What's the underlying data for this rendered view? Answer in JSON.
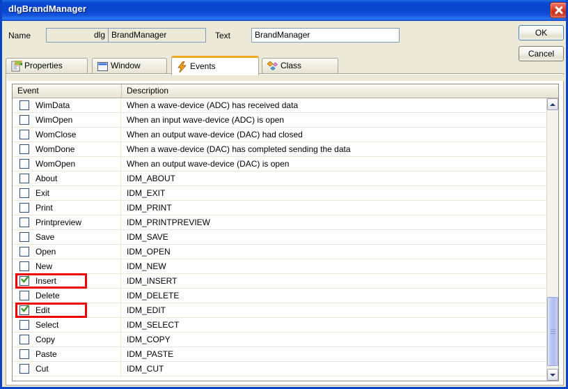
{
  "window": {
    "title": "dlgBrandManager",
    "close_icon": "close-icon"
  },
  "form": {
    "name_label": "Name",
    "name_prefix_value": "dlg",
    "name_value": "BrandManager",
    "text_label": "Text",
    "text_value": "BrandManager",
    "ok_label": "OK",
    "cancel_label": "Cancel"
  },
  "tabs": [
    {
      "label": "Properties",
      "icon": "properties-document-icon",
      "active": false
    },
    {
      "label": "Window",
      "icon": "window-icon",
      "active": false
    },
    {
      "label": "Events",
      "icon": "lightning-bolt-icon",
      "active": true
    },
    {
      "label": "Class",
      "icon": "class-diamonds-icon",
      "active": false
    }
  ],
  "list": {
    "columns": [
      "Event",
      "Description"
    ],
    "rows": [
      {
        "event": "WimData",
        "description": "When a wave-device (ADC) has received data",
        "checked": false,
        "annotated": false
      },
      {
        "event": "WimOpen",
        "description": "When an input wave-device (ADC) is open",
        "checked": false,
        "annotated": false
      },
      {
        "event": "WomClose",
        "description": "When an output wave-device (DAC) had closed",
        "checked": false,
        "annotated": false
      },
      {
        "event": "WomDone",
        "description": "When a wave-device (DAC) has completed sending the data",
        "checked": false,
        "annotated": false
      },
      {
        "event": "WomOpen",
        "description": "When an output wave-device (DAC) is open",
        "checked": false,
        "annotated": false
      },
      {
        "event": "About",
        "description": "IDM_ABOUT",
        "checked": false,
        "annotated": false
      },
      {
        "event": "Exit",
        "description": "IDM_EXIT",
        "checked": false,
        "annotated": false
      },
      {
        "event": "Print",
        "description": "IDM_PRINT",
        "checked": false,
        "annotated": false
      },
      {
        "event": "Printpreview",
        "description": "IDM_PRINTPREVIEW",
        "checked": false,
        "annotated": false
      },
      {
        "event": "Save",
        "description": "IDM_SAVE",
        "checked": false,
        "annotated": false
      },
      {
        "event": "Open",
        "description": "IDM_OPEN",
        "checked": false,
        "annotated": false
      },
      {
        "event": "New",
        "description": "IDM_NEW",
        "checked": false,
        "annotated": false
      },
      {
        "event": "Insert",
        "description": "IDM_INSERT",
        "checked": true,
        "annotated": true
      },
      {
        "event": "Delete",
        "description": "IDM_DELETE",
        "checked": false,
        "annotated": false
      },
      {
        "event": "Edit",
        "description": "IDM_EDIT",
        "checked": true,
        "annotated": true
      },
      {
        "event": "Select",
        "description": "IDM_SELECT",
        "checked": false,
        "annotated": false
      },
      {
        "event": "Copy",
        "description": "IDM_COPY",
        "checked": false,
        "annotated": false
      },
      {
        "event": "Paste",
        "description": "IDM_PASTE",
        "checked": false,
        "annotated": false
      },
      {
        "event": "Cut",
        "description": "IDM_CUT",
        "checked": false,
        "annotated": false
      }
    ],
    "scrollbar": {
      "up_icon": "scroll-up-arrow-icon",
      "down_icon": "scroll-down-arrow-icon"
    }
  },
  "colors": {
    "titlebar_blue": "#0b45cd",
    "dialog_face": "#ece9d8",
    "active_tab_accent": "#f0a823",
    "annotation_red": "#ee0000",
    "check_green": "#3a9c28"
  }
}
